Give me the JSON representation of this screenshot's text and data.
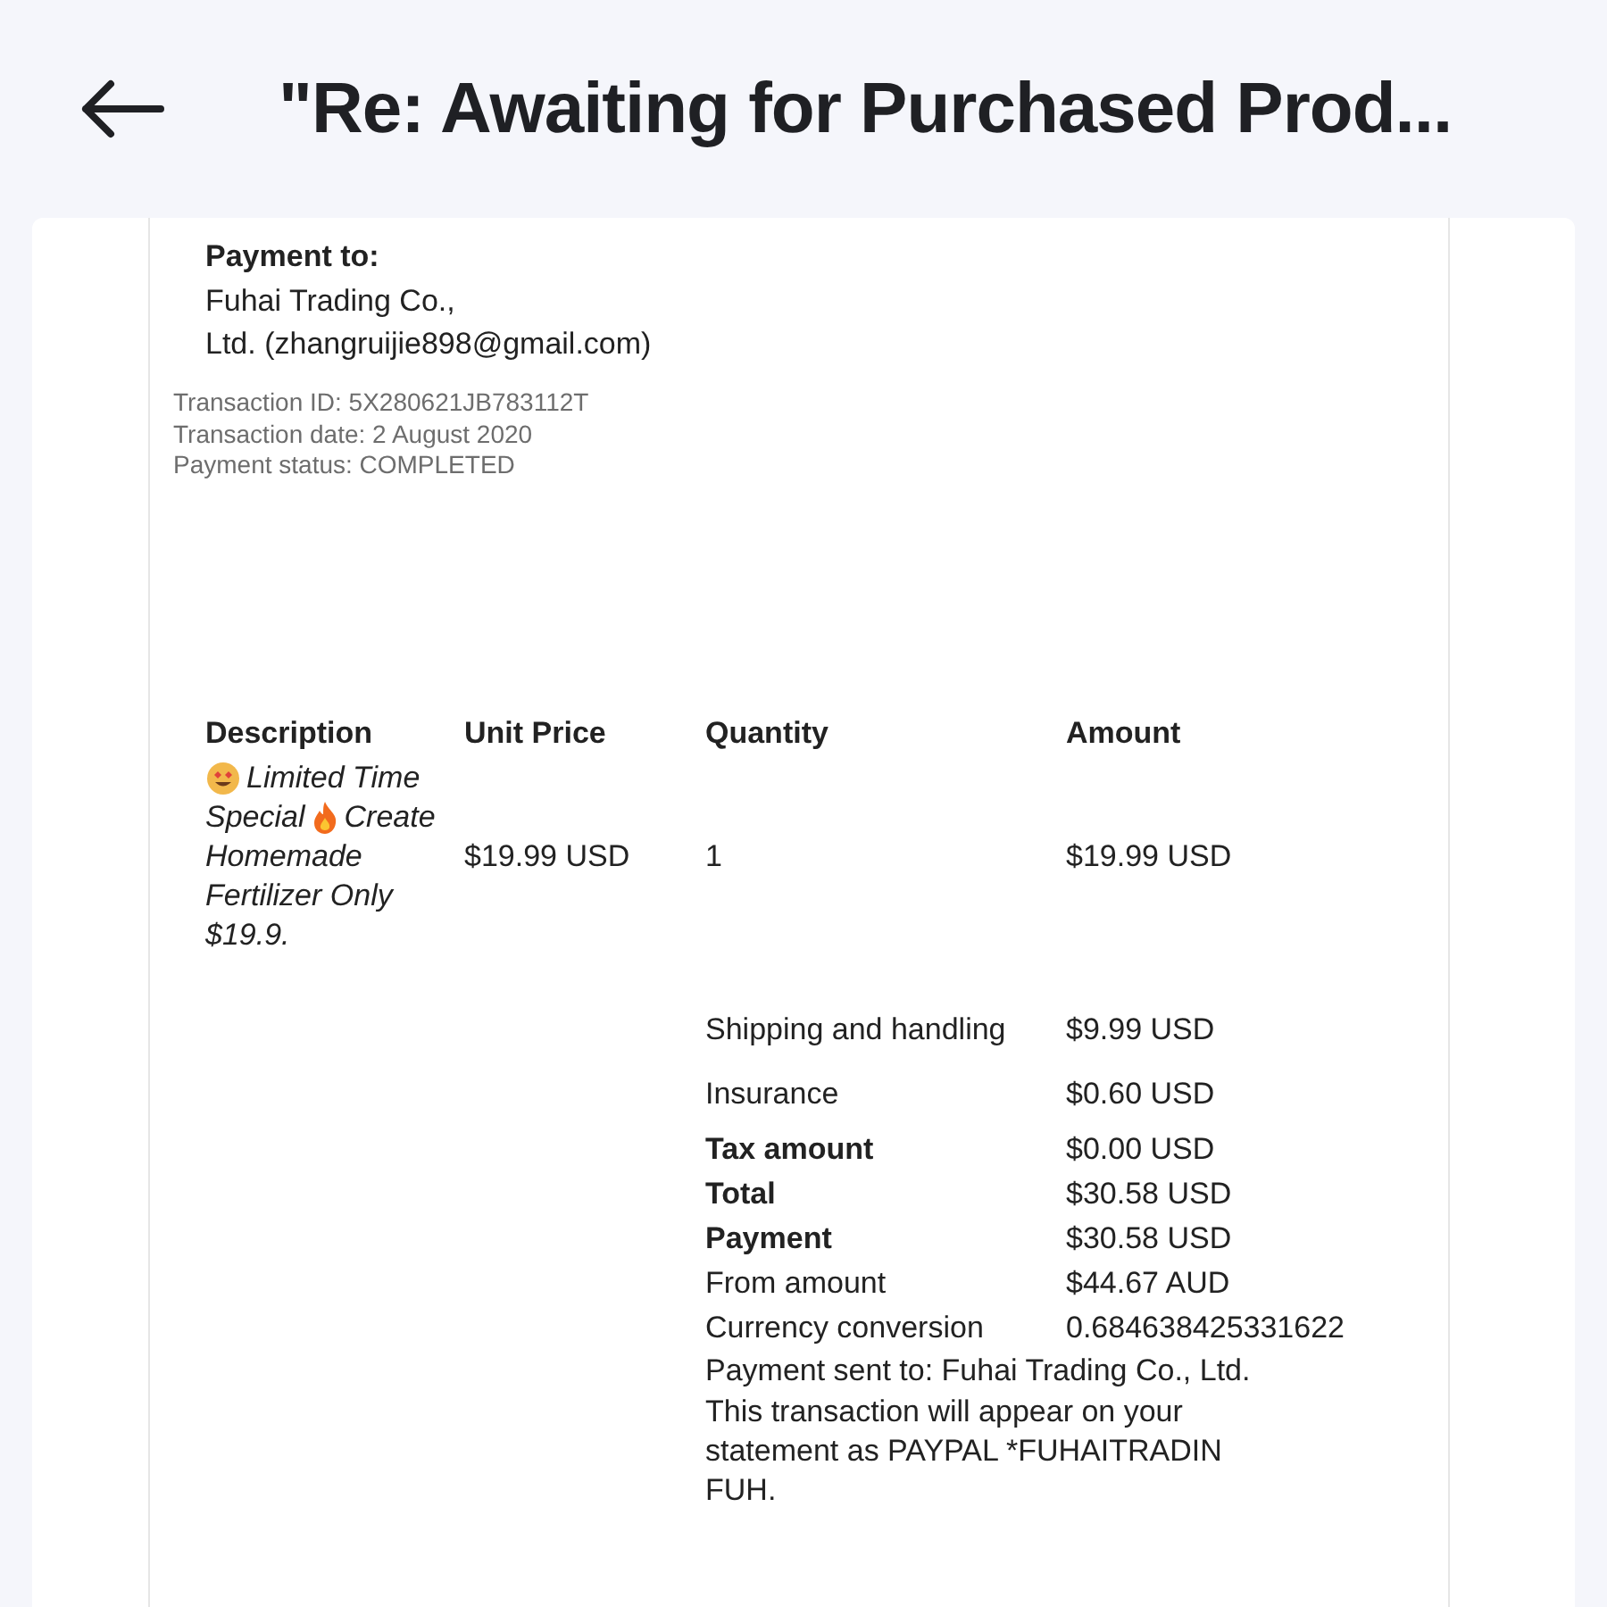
{
  "header": {
    "title": "\"Re: Awaiting for Purchased Prod..."
  },
  "payment_to": {
    "heading": "Payment to:",
    "payee_lines": [
      "Fuhai Trading Co.,",
      "Ltd. (zhangruijie898@gmail.com)"
    ]
  },
  "transaction_info": [
    "Transaction ID: 5X280621JB783112T",
    "Transaction date: 2 August 2020",
    "Payment status: COMPLETED"
  ],
  "table": {
    "columns": [
      "Description",
      "Unit Price",
      "Quantity",
      "Amount"
    ],
    "rows": [
      {
        "description_lines": [
          [
            {
              "kind": "smiley"
            },
            {
              "kind": "text",
              "text": "Limited Time"
            }
          ],
          [
            {
              "kind": "text",
              "text": "Special"
            },
            {
              "kind": "flame"
            },
            {
              "kind": "text",
              "text": "Create"
            }
          ],
          [
            {
              "kind": "text",
              "text": "Homemade"
            }
          ],
          [
            {
              "kind": "text",
              "text": "Fertilizer Only"
            }
          ],
          [
            {
              "kind": "text",
              "text": "$19.9."
            }
          ]
        ],
        "unit_price": "$19.99 USD",
        "quantity": "1",
        "amount": "$19.99 USD"
      }
    ]
  },
  "summary": [
    {
      "label": "Shipping and handling",
      "value": "$9.99 USD",
      "bold": false,
      "gap": true
    },
    {
      "label": "Insurance",
      "value": "$0.60 USD",
      "bold": false,
      "gap": true
    },
    {
      "label": "Tax amount",
      "value": "$0.00 USD",
      "bold": true,
      "gap": false
    },
    {
      "label": "Total",
      "value": "$30.58 USD",
      "bold": true,
      "gap": false
    },
    {
      "label": "Payment",
      "value": "$30.58 USD",
      "bold": true,
      "gap": false
    },
    {
      "label": "From amount",
      "value": "$44.67 AUD",
      "bold": false,
      "gap": false
    },
    {
      "label": "Currency conversion",
      "value": "0.684638425331622",
      "bold": false,
      "gap": false
    }
  ],
  "notes": [
    "Payment sent to: Fuhai Trading Co., Ltd.",
    "This transaction will appear on your statement as PAYPAL *FUHAITRADIN FUH."
  ]
}
